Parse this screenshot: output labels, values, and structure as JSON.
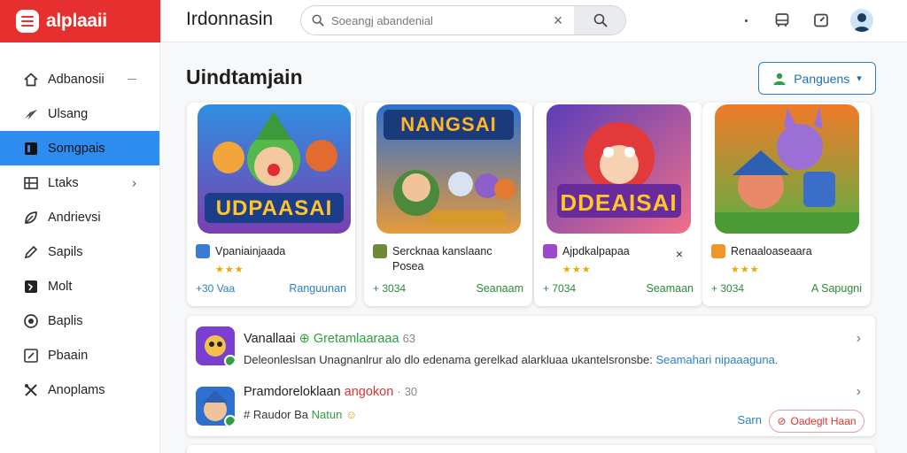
{
  "brand": {
    "name": "alplaaii"
  },
  "header": {
    "title": "Irdonnasin",
    "search": {
      "placeholder": "Soeangj abandenial",
      "value": ""
    }
  },
  "sidebar": {
    "items": [
      {
        "label": "Adbanosii",
        "icon": "home-icon"
      },
      {
        "label": "Ulsang",
        "icon": "send-icon"
      },
      {
        "label": "Somgpais",
        "icon": "square-icon",
        "active": true
      },
      {
        "label": "Ltaks",
        "icon": "grid-icon"
      },
      {
        "label": "Andrievsi",
        "icon": "leaf-icon"
      },
      {
        "label": "Sapils",
        "icon": "edit-icon"
      },
      {
        "label": "Molt",
        "icon": "bolt-icon"
      },
      {
        "label": "Baplis",
        "icon": "globe-icon"
      },
      {
        "label": "Pbaain",
        "icon": "pen-icon"
      },
      {
        "label": "Anoplams",
        "icon": "tools-icon"
      }
    ]
  },
  "main": {
    "section_title": "Uindtamjain",
    "follow_button": "Panguens",
    "cards": [
      {
        "banner": "UDPAASAI",
        "title": "Vpaniainjaada",
        "stars": "★★★",
        "stat": "+30 Vaa",
        "link": "Ranguunan",
        "color": "#2a7fc5"
      },
      {
        "banner": "NANGSAI",
        "title": "Sercknaa kanslaanc Posea",
        "stars": "",
        "stat": "+ 3034",
        "link": "Seanaam",
        "color": "#2d8a3b"
      },
      {
        "banner": "DDEAISAI",
        "title": "Ajpdkalpapaa",
        "stars": "★★★",
        "stat": "+ 7034",
        "link": "Seamaan",
        "color": "#2d8a3b"
      },
      {
        "banner": "",
        "title": "Renaaloaseaara",
        "stars": "★★★",
        "stat": "+ 3034",
        "link": "A Sapugni",
        "color": "#2d8a3b"
      }
    ],
    "feed": [
      {
        "title": "Vanallaai",
        "highlight": "Gretamlaaraaa",
        "meta": "63",
        "desc": "Deleonleslsan Unagnanlrur alo dlo edenama gerelkad alarkluaa ukantelsronsbe:",
        "desc_link": "Seamahari nipaaaguna."
      },
      {
        "title": "Pramdoreloklaan",
        "highlight": "angokon",
        "meta": "30",
        "desc": "Raudor Ba",
        "desc_green": "Natun",
        "link": "Sarn",
        "report": "Oadeglt Haan"
      }
    ]
  },
  "colors": {
    "brand": "#e5302f",
    "accent": "#2d8cf0",
    "link": "#2a7fc5",
    "success": "#2f9e44"
  }
}
